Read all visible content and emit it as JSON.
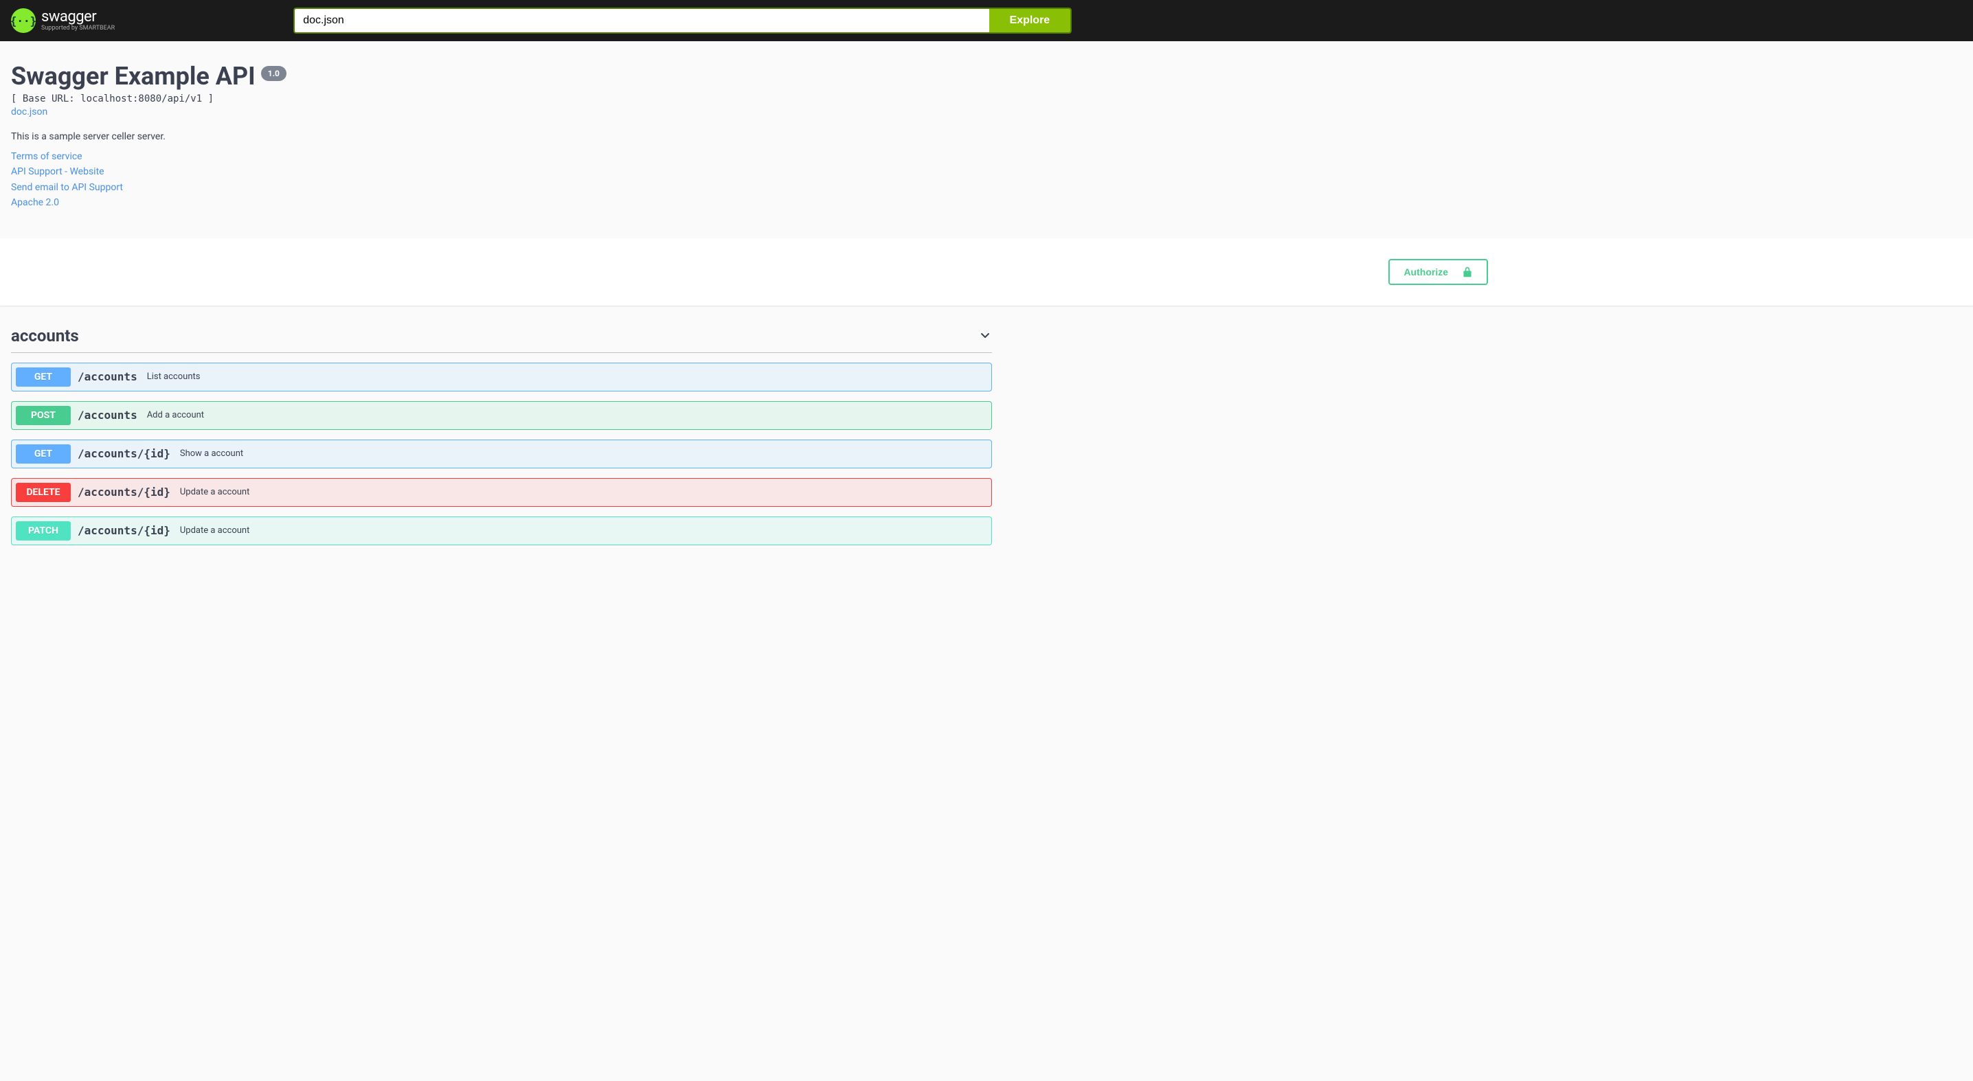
{
  "topbar": {
    "logo_text": "swagger",
    "logo_sub": "Supported by SMARTBEAR",
    "input_value": "doc.json",
    "explore_label": "Explore"
  },
  "info": {
    "title": "Swagger Example API",
    "version": "1.0",
    "base_url": "[ Base URL: localhost:8080/api/v1 ]",
    "doc_link": "doc.json",
    "description": "This is a sample server celler server.",
    "terms_label": "Terms of service",
    "contact_website_label": "API Support - Website",
    "contact_email_label": "Send email to API Support",
    "license_label": "Apache 2.0"
  },
  "scheme": {
    "authorize_label": "Authorize"
  },
  "tag": {
    "name": "accounts"
  },
  "operations": [
    {
      "method": "GET",
      "method_class": "get",
      "path": "/accounts",
      "summary": "List accounts"
    },
    {
      "method": "POST",
      "method_class": "post",
      "path": "/accounts",
      "summary": "Add a account"
    },
    {
      "method": "GET",
      "method_class": "get",
      "path": "/accounts/{id}",
      "summary": "Show a account"
    },
    {
      "method": "DELETE",
      "method_class": "delete",
      "path": "/accounts/{id}",
      "summary": "Update a account"
    },
    {
      "method": "PATCH",
      "method_class": "patch",
      "path": "/accounts/{id}",
      "summary": "Update a account"
    }
  ]
}
